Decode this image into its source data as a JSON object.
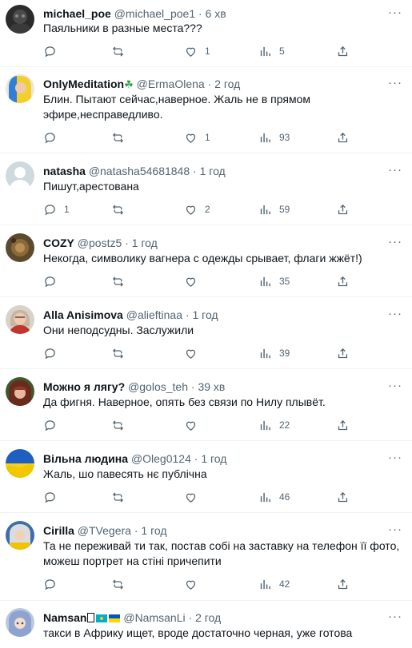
{
  "tweets": [
    {
      "name": "michael_poe",
      "handle": "@michael_poe1",
      "time": "6 хв",
      "text": "Паяльники в разные места???",
      "replies": "",
      "retweets": "",
      "likes": "1",
      "views": "5",
      "avatar": "dark-avatar"
    },
    {
      "name": "OnlyMeditation",
      "name_badge": "☘",
      "handle": "@ErmaOlena",
      "time": "2 год",
      "text": "Блин. Пытают сейчас,наверное. Жаль не в прямом эфире,несправедливо.",
      "replies": "",
      "retweets": "",
      "likes": "1",
      "views": "93",
      "avatar": "blue-yellow-hair-avatar"
    },
    {
      "name": "natasha",
      "handle": "@natasha54681848",
      "time": "1 год",
      "text": "Пишут,арестована",
      "replies": "1",
      "retweets": "",
      "likes": "2",
      "views": "59",
      "avatar": "default-avatar"
    },
    {
      "name": "COZY",
      "handle": "@postz5",
      "time": "1 год",
      "text": "Некогда, символику вагнера с одежды срывает, флаги жжёт!)",
      "replies": "",
      "retweets": "",
      "likes": "",
      "views": "35",
      "avatar": "brown-avatar"
    },
    {
      "name": "Alla Anisimova",
      "handle": "@alieftinaa",
      "time": "1 год",
      "text": "Они неподсудны. Заслужили",
      "replies": "",
      "retweets": "",
      "likes": "",
      "views": "39",
      "avatar": "woman-avatar"
    },
    {
      "name": "Можно я лягу?",
      "handle": "@golos_teh",
      "time": "39 хв",
      "text": "Да фигня. Наверное, опять без связи по Нилу плывёт.",
      "replies": "",
      "retweets": "",
      "likes": "",
      "views": "22",
      "avatar": "hood-avatar"
    },
    {
      "name": "Вільна людина",
      "handle": "@Oleg0124",
      "time": "1 год",
      "text": "Жаль, шо павесять нє публічна",
      "replies": "",
      "retweets": "",
      "likes": "",
      "views": "46",
      "avatar": "ukraine-flag-avatar"
    },
    {
      "name": "Cirilla",
      "handle": "@TVegera",
      "time": "1 год",
      "text": "Та не переживай ти так, постав собі на заставку на телефон її фото, можеш портрет на стіні причепити",
      "replies": "",
      "retweets": "",
      "likes": "",
      "views": "42",
      "avatar": "cirilla-avatar"
    },
    {
      "name": "Namsan",
      "handle": "@NamsanLi",
      "time": "2 год",
      "text": "такси в Африку ищет, вроде достаточно черная, уже готова",
      "replies": "",
      "retweets": "",
      "likes": "",
      "views": "",
      "avatar": "anime-avatar"
    }
  ],
  "separator": "·",
  "more_label": "···",
  "colors": {
    "text": "#0f1419",
    "secondary": "#536471",
    "divider": "#eff3f4",
    "clover": "#2ea043"
  },
  "icons": [
    "reply-icon",
    "retweet-icon",
    "like-icon",
    "views-icon",
    "share-icon",
    "more-icon"
  ]
}
